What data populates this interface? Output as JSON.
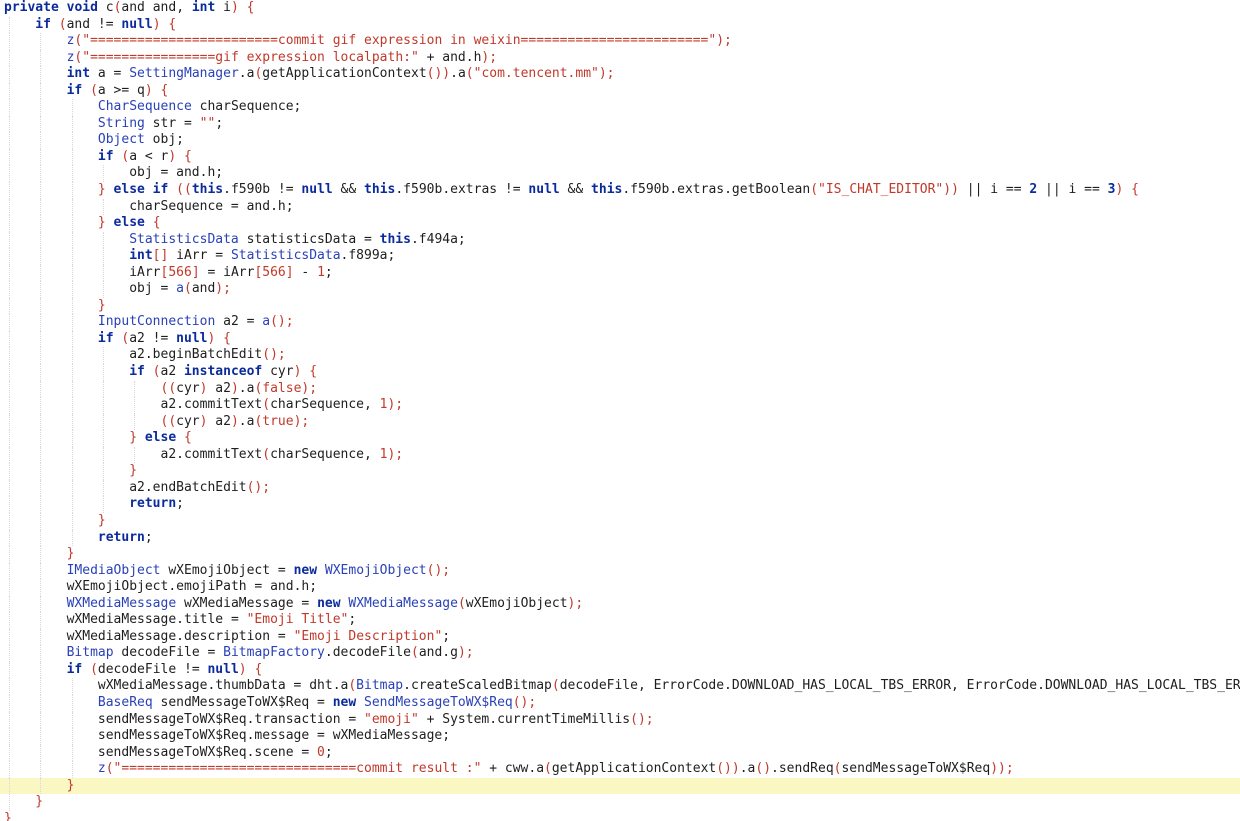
{
  "editor": {
    "highlighted_line": 47,
    "colors": {
      "keyword": "#0b2b9c",
      "string": "#c0392b",
      "type": "#2a41b8",
      "text": "#1e1e1e",
      "highlight": "#fbf7c3"
    },
    "lines": [
      {
        "indent": 0,
        "tokens": [
          [
            "k",
            "private void "
          ],
          [
            "v",
            "c"
          ],
          [
            "p",
            "("
          ],
          [
            "v",
            "and and, "
          ],
          [
            "k",
            "int "
          ],
          [
            "v",
            "i"
          ],
          [
            "p",
            ") {"
          ]
        ]
      },
      {
        "indent": 1,
        "tokens": [
          [
            "k",
            "if "
          ],
          [
            "p",
            "("
          ],
          [
            "v",
            "and != "
          ],
          [
            "k",
            "null"
          ],
          [
            "p",
            ") {"
          ]
        ]
      },
      {
        "indent": 2,
        "tokens": [
          [
            "f",
            "z"
          ],
          [
            "p",
            "("
          ],
          [
            "s",
            "\"========================commit gif expression in weixin========================\""
          ],
          [
            "p",
            ");"
          ]
        ]
      },
      {
        "indent": 2,
        "tokens": [
          [
            "f",
            "z"
          ],
          [
            "p",
            "("
          ],
          [
            "s",
            "\"================gif expression localpath:\""
          ],
          [
            "v",
            " + and.h"
          ],
          [
            "p",
            ");"
          ]
        ]
      },
      {
        "indent": 2,
        "tokens": [
          [
            "k",
            "int "
          ],
          [
            "v",
            "a = "
          ],
          [
            "t",
            "SettingManager"
          ],
          [
            "v",
            ".a"
          ],
          [
            "p",
            "("
          ],
          [
            "v",
            "getApplicationContext"
          ],
          [
            "p",
            "())"
          ],
          [
            "v",
            ".a"
          ],
          [
            "p",
            "("
          ],
          [
            "s",
            "\"com.tencent.mm\""
          ],
          [
            "p",
            ");"
          ]
        ]
      },
      {
        "indent": 2,
        "tokens": [
          [
            "k",
            "if "
          ],
          [
            "p",
            "("
          ],
          [
            "v",
            "a >= q"
          ],
          [
            "p",
            ") {"
          ]
        ]
      },
      {
        "indent": 3,
        "tokens": [
          [
            "t",
            "CharSequence"
          ],
          [
            "v",
            " charSequence;"
          ]
        ]
      },
      {
        "indent": 3,
        "tokens": [
          [
            "t",
            "String"
          ],
          [
            "v",
            " str = "
          ],
          [
            "s",
            "\"\""
          ],
          [
            "v",
            ";"
          ]
        ]
      },
      {
        "indent": 3,
        "tokens": [
          [
            "t",
            "Object"
          ],
          [
            "v",
            " obj;"
          ]
        ]
      },
      {
        "indent": 3,
        "tokens": [
          [
            "k",
            "if "
          ],
          [
            "p",
            "("
          ],
          [
            "v",
            "a < r"
          ],
          [
            "p",
            ") {"
          ]
        ]
      },
      {
        "indent": 4,
        "tokens": [
          [
            "v",
            "obj = and.h;"
          ]
        ]
      },
      {
        "indent": 3,
        "tokens": [
          [
            "p",
            "} "
          ],
          [
            "k",
            "else if "
          ],
          [
            "p",
            "(("
          ],
          [
            "k",
            "this"
          ],
          [
            "v",
            ".f590b != "
          ],
          [
            "k",
            "null"
          ],
          [
            "v",
            " && "
          ],
          [
            "k",
            "this"
          ],
          [
            "v",
            ".f590b.extras != "
          ],
          [
            "k",
            "null"
          ],
          [
            "v",
            " && "
          ],
          [
            "k",
            "this"
          ],
          [
            "v",
            ".f590b.extras.getBoolean"
          ],
          [
            "p",
            "("
          ],
          [
            "s",
            "\"IS_CHAT_EDITOR\""
          ],
          [
            "p",
            "))"
          ],
          [
            "v",
            " || i == "
          ],
          [
            "k",
            "2"
          ],
          [
            "v",
            " || i == "
          ],
          [
            "k",
            "3"
          ],
          [
            "p",
            ") {"
          ]
        ]
      },
      {
        "indent": 4,
        "tokens": [
          [
            "v",
            "charSequence = and.h;"
          ]
        ]
      },
      {
        "indent": 3,
        "tokens": [
          [
            "p",
            "} "
          ],
          [
            "k",
            "else "
          ],
          [
            "p",
            "{"
          ]
        ]
      },
      {
        "indent": 4,
        "tokens": [
          [
            "t",
            "StatisticsData"
          ],
          [
            "v",
            " statisticsData = "
          ],
          [
            "k",
            "this"
          ],
          [
            "v",
            ".f494a;"
          ]
        ]
      },
      {
        "indent": 4,
        "tokens": [
          [
            "k",
            "int"
          ],
          [
            "p",
            "[] "
          ],
          [
            "v",
            "iArr = "
          ],
          [
            "t",
            "StatisticsData"
          ],
          [
            "v",
            ".f899a;"
          ]
        ]
      },
      {
        "indent": 4,
        "tokens": [
          [
            "v",
            "iArr"
          ],
          [
            "p",
            "["
          ],
          [
            "s",
            "566"
          ],
          [
            "p",
            "]"
          ],
          [
            "v",
            " = iArr"
          ],
          [
            "p",
            "["
          ],
          [
            "s",
            "566"
          ],
          [
            "p",
            "]"
          ],
          [
            "v",
            " - "
          ],
          [
            "s",
            "1"
          ],
          [
            "v",
            ";"
          ]
        ]
      },
      {
        "indent": 4,
        "tokens": [
          [
            "v",
            "obj = "
          ],
          [
            "f",
            "a"
          ],
          [
            "p",
            "("
          ],
          [
            "v",
            "and"
          ],
          [
            "p",
            ");"
          ]
        ]
      },
      {
        "indent": 3,
        "tokens": [
          [
            "p",
            "}"
          ]
        ]
      },
      {
        "indent": 3,
        "tokens": [
          [
            "t",
            "InputConnection"
          ],
          [
            "v",
            " a2 = "
          ],
          [
            "f",
            "a"
          ],
          [
            "p",
            "();"
          ]
        ]
      },
      {
        "indent": 3,
        "tokens": [
          [
            "k",
            "if "
          ],
          [
            "p",
            "("
          ],
          [
            "v",
            "a2 != "
          ],
          [
            "k",
            "null"
          ],
          [
            "p",
            ") {"
          ]
        ]
      },
      {
        "indent": 4,
        "tokens": [
          [
            "v",
            "a2.beginBatchEdit"
          ],
          [
            "p",
            "();"
          ]
        ]
      },
      {
        "indent": 4,
        "tokens": [
          [
            "k",
            "if "
          ],
          [
            "p",
            "("
          ],
          [
            "v",
            "a2 "
          ],
          [
            "k",
            "instanceof "
          ],
          [
            "v",
            "cyr"
          ],
          [
            "p",
            ") {"
          ]
        ]
      },
      {
        "indent": 5,
        "tokens": [
          [
            "p",
            "(("
          ],
          [
            "v",
            "cyr"
          ],
          [
            "p",
            ") "
          ],
          [
            "v",
            "a2"
          ],
          [
            "p",
            ")"
          ],
          [
            "v",
            ".a"
          ],
          [
            "p",
            "("
          ],
          [
            "s",
            "false"
          ],
          [
            "p",
            ");"
          ]
        ]
      },
      {
        "indent": 5,
        "tokens": [
          [
            "v",
            "a2.commitText"
          ],
          [
            "p",
            "("
          ],
          [
            "v",
            "charSequence, "
          ],
          [
            "s",
            "1"
          ],
          [
            "p",
            ");"
          ]
        ]
      },
      {
        "indent": 5,
        "tokens": [
          [
            "p",
            "(("
          ],
          [
            "v",
            "cyr"
          ],
          [
            "p",
            ") "
          ],
          [
            "v",
            "a2"
          ],
          [
            "p",
            ")"
          ],
          [
            "v",
            ".a"
          ],
          [
            "p",
            "("
          ],
          [
            "s",
            "true"
          ],
          [
            "p",
            ");"
          ]
        ]
      },
      {
        "indent": 4,
        "tokens": [
          [
            "p",
            "} "
          ],
          [
            "k",
            "else "
          ],
          [
            "p",
            "{"
          ]
        ]
      },
      {
        "indent": 5,
        "tokens": [
          [
            "v",
            "a2.commitText"
          ],
          [
            "p",
            "("
          ],
          [
            "v",
            "charSequence, "
          ],
          [
            "s",
            "1"
          ],
          [
            "p",
            ");"
          ]
        ]
      },
      {
        "indent": 4,
        "tokens": [
          [
            "p",
            "}"
          ]
        ]
      },
      {
        "indent": 4,
        "tokens": [
          [
            "v",
            "a2.endBatchEdit"
          ],
          [
            "p",
            "();"
          ]
        ]
      },
      {
        "indent": 4,
        "tokens": [
          [
            "k",
            "return"
          ],
          [
            "v",
            ";"
          ]
        ]
      },
      {
        "indent": 3,
        "tokens": [
          [
            "p",
            "}"
          ]
        ]
      },
      {
        "indent": 3,
        "tokens": [
          [
            "k",
            "return"
          ],
          [
            "v",
            ";"
          ]
        ]
      },
      {
        "indent": 2,
        "tokens": [
          [
            "p",
            "}"
          ]
        ]
      },
      {
        "indent": 2,
        "tokens": [
          [
            "t",
            "IMediaObject"
          ],
          [
            "v",
            " wXEmojiObject = "
          ],
          [
            "k",
            "new "
          ],
          [
            "t",
            "WXEmojiObject"
          ],
          [
            "p",
            "();"
          ]
        ]
      },
      {
        "indent": 2,
        "tokens": [
          [
            "v",
            "wXEmojiObject.emojiPath = and.h;"
          ]
        ]
      },
      {
        "indent": 2,
        "tokens": [
          [
            "t",
            "WXMediaMessage"
          ],
          [
            "v",
            " wXMediaMessage = "
          ],
          [
            "k",
            "new "
          ],
          [
            "t",
            "WXMediaMessage"
          ],
          [
            "p",
            "("
          ],
          [
            "v",
            "wXEmojiObject"
          ],
          [
            "p",
            ");"
          ]
        ]
      },
      {
        "indent": 2,
        "tokens": [
          [
            "v",
            "wXMediaMessage.title = "
          ],
          [
            "s",
            "\"Emoji Title\""
          ],
          [
            "v",
            ";"
          ]
        ]
      },
      {
        "indent": 2,
        "tokens": [
          [
            "v",
            "wXMediaMessage.description = "
          ],
          [
            "s",
            "\"Emoji Description\""
          ],
          [
            "v",
            ";"
          ]
        ]
      },
      {
        "indent": 2,
        "tokens": [
          [
            "t",
            "Bitmap"
          ],
          [
            "v",
            " decodeFile = "
          ],
          [
            "t",
            "BitmapFactory"
          ],
          [
            "v",
            ".decodeFile"
          ],
          [
            "p",
            "("
          ],
          [
            "v",
            "and.g"
          ],
          [
            "p",
            ");"
          ]
        ]
      },
      {
        "indent": 2,
        "tokens": [
          [
            "k",
            "if "
          ],
          [
            "p",
            "("
          ],
          [
            "v",
            "decodeFile != "
          ],
          [
            "k",
            "null"
          ],
          [
            "p",
            ") {"
          ]
        ]
      },
      {
        "indent": 3,
        "tokens": [
          [
            "v",
            "wXMediaMessage.thumbData = dht.a"
          ],
          [
            "p",
            "("
          ],
          [
            "t",
            "Bitmap"
          ],
          [
            "v",
            ".createScaledBitmap"
          ],
          [
            "p",
            "("
          ],
          [
            "v",
            "decodeFile, ErrorCode.DOWNLOAD_HAS_LOCAL_TBS_ERROR, ErrorCode.DOWNLOAD_HAS_LOCAL_TBS_ER"
          ]
        ]
      },
      {
        "indent": 3,
        "tokens": [
          [
            "t",
            "BaseReq"
          ],
          [
            "v",
            " sendMessageToWX$Req = "
          ],
          [
            "k",
            "new "
          ],
          [
            "t",
            "SendMessageToWX$Req"
          ],
          [
            "p",
            "();"
          ]
        ]
      },
      {
        "indent": 3,
        "tokens": [
          [
            "v",
            "sendMessageToWX$Req.transaction = "
          ],
          [
            "s",
            "\"emoji\""
          ],
          [
            "v",
            " + System.currentTimeMillis"
          ],
          [
            "p",
            "();"
          ]
        ]
      },
      {
        "indent": 3,
        "tokens": [
          [
            "v",
            "sendMessageToWX$Req.message = wXMediaMessage;"
          ]
        ]
      },
      {
        "indent": 3,
        "tokens": [
          [
            "v",
            "sendMessageToWX$Req.scene = "
          ],
          [
            "s",
            "0"
          ],
          [
            "v",
            ";"
          ]
        ]
      },
      {
        "indent": 3,
        "tokens": [
          [
            "f",
            "z"
          ],
          [
            "p",
            "("
          ],
          [
            "s",
            "\"==============================commit result :\""
          ],
          [
            "v",
            " + cww.a"
          ],
          [
            "p",
            "("
          ],
          [
            "v",
            "getApplicationContext"
          ],
          [
            "p",
            "())"
          ],
          [
            "v",
            ".a"
          ],
          [
            "p",
            "()"
          ],
          [
            "v",
            ".sendReq"
          ],
          [
            "p",
            "("
          ],
          [
            "v",
            "sendMessageToWX$Req"
          ],
          [
            "p",
            "));"
          ]
        ]
      },
      {
        "indent": 2,
        "tokens": [
          [
            "p",
            "}"
          ]
        ]
      },
      {
        "indent": 1,
        "tokens": [
          [
            "p",
            "}"
          ]
        ]
      },
      {
        "indent": 0,
        "tokens": [
          [
            "p",
            "}"
          ]
        ]
      }
    ]
  }
}
